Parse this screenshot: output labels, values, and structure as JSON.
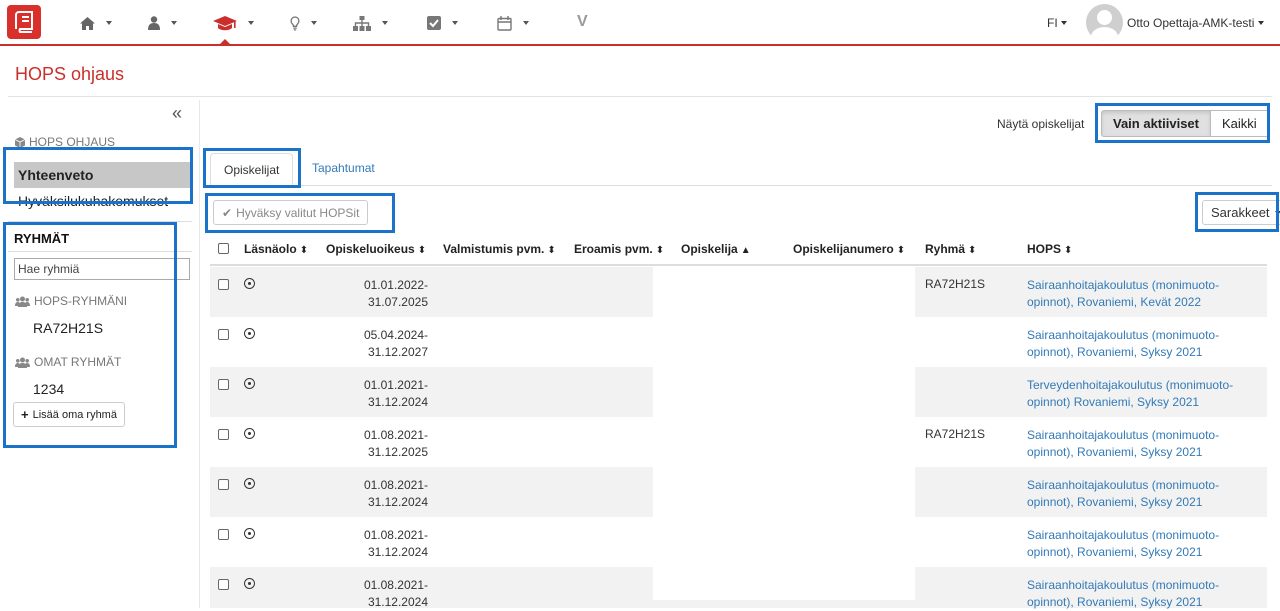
{
  "nav": {
    "items": [
      {
        "name": "home-icon"
      },
      {
        "name": "user-icon"
      },
      {
        "name": "graduation-cap-icon"
      },
      {
        "name": "lightbulb-icon"
      },
      {
        "name": "sitemap-icon"
      },
      {
        "name": "checkbox-icon"
      },
      {
        "name": "calendar-icon"
      }
    ],
    "v_label": "V",
    "lang": "FI",
    "user_name": "Otto Opettaja-AMK-testi"
  },
  "page": {
    "title": "HOPS ohjaus"
  },
  "sidebar": {
    "collapse": "«",
    "header": "HOPS OHJAUS",
    "items": [
      {
        "label": "Yhteenveto"
      },
      {
        "label": "Hyväksilukuhakemukset"
      }
    ],
    "groups_title": "RYHMÄT",
    "search_placeholder": "Hae ryhmiä",
    "hops_groups_label": "HOPS-RYHMÄNI",
    "hops_groups": [
      "RA72H21S"
    ],
    "own_groups_label": "OMAT RYHMÄT",
    "own_groups": [
      "1234"
    ],
    "add_group": "Lisää oma ryhmä"
  },
  "main": {
    "show_label": "Näytä opiskelijat",
    "filter_active": "Vain aktiiviset",
    "filter_all": "Kaikki",
    "tabs": [
      {
        "label": "Opiskelijat"
      },
      {
        "label": "Tapahtumat"
      }
    ],
    "approve_button": "Hyväksy valitut HOPSit",
    "columns_button": "Sarakkeet"
  },
  "table": {
    "headers": [
      {
        "label": "Läsnäolo",
        "sort": "⬍"
      },
      {
        "label": "Opiskeluoikeus",
        "sort": "⬍"
      },
      {
        "label": "Valmistumis pvm.",
        "sort": "⬍"
      },
      {
        "label": "Eroamis pvm.",
        "sort": "⬍"
      },
      {
        "label": "Opiskelija",
        "sort": "▲"
      },
      {
        "label": "Opiskelijanumero",
        "sort": "⬍"
      },
      {
        "label": "Ryhmä",
        "sort": "⬍"
      },
      {
        "label": "HOPS",
        "sort": "⬍"
      }
    ],
    "rows": [
      {
        "start": "01.01.2022-",
        "end": "31.07.2025",
        "group": "RA72H21S",
        "hops1": "Sairaanhoitajakoulutus (monimuoto-",
        "hops2": "opinnot), Rovaniemi, Kevät 2022"
      },
      {
        "start": "05.04.2024-",
        "end": "31.12.2027",
        "group": "",
        "hops1": "Sairaanhoitajakoulutus (monimuoto-",
        "hops2": "opinnot), Rovaniemi, Syksy 2021"
      },
      {
        "start": "01.01.2021-",
        "end": "31.12.2024",
        "group": "",
        "hops1": "Terveydenhoitajakoulutus (monimuoto-",
        "hops2": "opinnot) Rovaniemi, Syksy 2021"
      },
      {
        "start": "01.08.2021-",
        "end": "31.12.2025",
        "group": "RA72H21S",
        "hops1": "Sairaanhoitajakoulutus (monimuoto-",
        "hops2": "opinnot), Rovaniemi, Syksy 2021"
      },
      {
        "start": "01.08.2021-",
        "end": "31.12.2024",
        "group": "",
        "hops1": "Sairaanhoitajakoulutus (monimuoto-",
        "hops2": "opinnot), Rovaniemi, Syksy 2021"
      },
      {
        "start": "01.08.2021-",
        "end": "31.12.2024",
        "group": "",
        "hops1": "Sairaanhoitajakoulutus (monimuoto-",
        "hops2": "opinnot), Rovaniemi, Syksy 2021"
      },
      {
        "start": "01.08.2021-",
        "end": "31.12.2024",
        "group": "",
        "hops1": "Sairaanhoitajakoulutus (monimuoto-",
        "hops2": "opinnot), Rovaniemi, Syksy 2021"
      }
    ]
  },
  "colors": {
    "brand_red": "#c9302c",
    "link_blue": "#337ab7",
    "highlight_blue": "#1a73c8"
  }
}
